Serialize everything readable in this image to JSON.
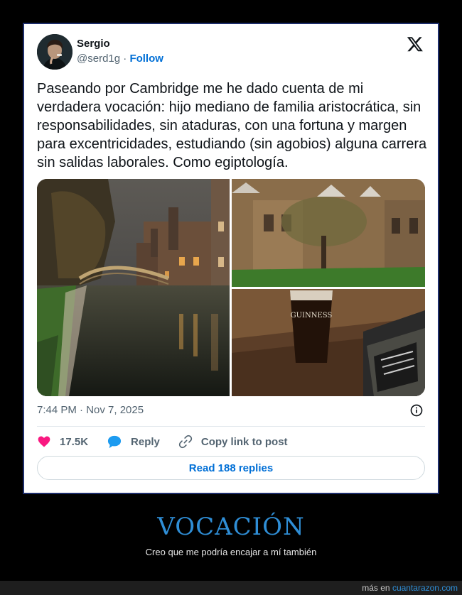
{
  "tweet": {
    "author": {
      "name": "Sergio",
      "handle": "@serd1g",
      "separator": "·",
      "follow_label": "Follow"
    },
    "text": "Paseando por Cambridge me he dado cuenta de mi verdadera vocación: hijo mediano de familia aristocrática, sin responsabilidades, sin ataduras, con una fortuna y margen para excentricidades, estudiando (sin agobios) alguna carrera sin salidas laborales. Como egiptología.",
    "photos": [
      "cambridge-river-night",
      "college-courtyard-tree",
      "guinness-pint"
    ],
    "photo_text": {
      "guinness_label": "GUINNESS"
    },
    "timestamp": "7:44 PM · Nov 7, 2025",
    "actions": {
      "likes": "17.5K",
      "reply_label": "Reply",
      "copy_link_label": "Copy link to post"
    },
    "read_replies_label": "Read 188 replies"
  },
  "poster": {
    "title": "VOCACIÓN",
    "subtitle": "Creo que me podría encajar a mí también"
  },
  "footer": {
    "prefix": "más en",
    "site": "cuantarazon.com"
  },
  "colors": {
    "page_background": "#000000",
    "frame_border": "#1d2d6b",
    "link_blue": "#006fd6",
    "like_pink": "#f91880",
    "reply_blue": "#1d9bf0",
    "poster_title": "#2f8ed6"
  },
  "icons": [
    "x-logo-icon",
    "info-icon",
    "heart-icon",
    "reply-bubble-icon",
    "link-icon"
  ]
}
